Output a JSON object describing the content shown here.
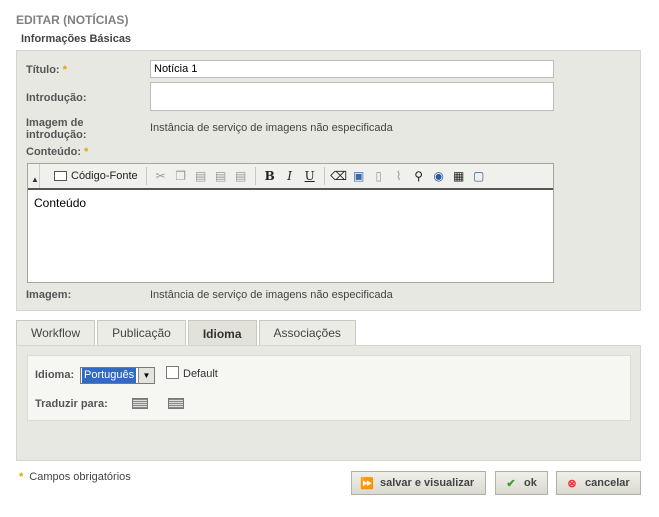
{
  "page": {
    "title": "EDITAR (NOTÍCIAS)",
    "section": "Informações Básicas"
  },
  "form": {
    "titulo_label": "Título:",
    "titulo_value": "Notícia 1",
    "introducao_label": "Introdução:",
    "introducao_value": "",
    "imagem_intro_label_1": "Imagem de",
    "imagem_intro_label_2": "introdução:",
    "imagem_intro_value": "Instância de serviço de imagens não especificada",
    "conteudo_label": "Conteúdo:",
    "imagem_label": "Imagem:",
    "imagem_value": "Instância de serviço de imagens não especificada",
    "required_mark": "*"
  },
  "editor": {
    "source_label": "Código-Fonte",
    "content": "Conteúdo",
    "icons": [
      "cut-icon",
      "copy-icon",
      "paste-icon",
      "paste-text-icon",
      "paste-word-icon",
      "bold-icon",
      "italic-icon",
      "underline-icon",
      "remove-format-icon",
      "image-icon",
      "page-icon",
      "attachment-icon",
      "find-icon",
      "link-icon",
      "table-icon",
      "preview-icon"
    ],
    "bold": "B",
    "italic": "I",
    "underline": "U"
  },
  "tabs": [
    "Workflow",
    "Publicação",
    "Idioma",
    "Associações"
  ],
  "idioma": {
    "label": "Idioma:",
    "selected": "Português",
    "default_label": "Default",
    "traduzir_label": "Traduzir para:"
  },
  "footer": {
    "required_note": "Campos obrigatórios",
    "save_view": "salvar e visualizar",
    "ok": "ok",
    "cancel": "cancelar"
  },
  "colors": {
    "required": "#e6a100",
    "selected": "#316ac5",
    "panel": "#e8e8e2"
  }
}
